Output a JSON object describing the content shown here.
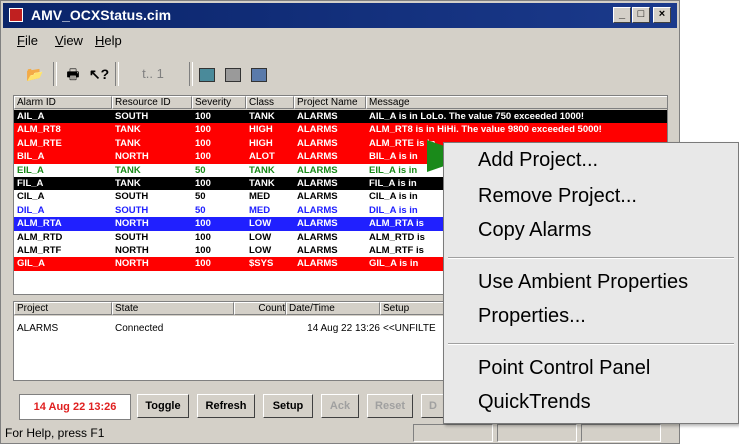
{
  "window": {
    "title": "AMV_OCXStatus.cim"
  },
  "menu": [
    "File",
    "View",
    "Help"
  ],
  "toolbar": {
    "num_label": "t..  1"
  },
  "alarm_grid": {
    "columns": [
      "Alarm ID",
      "Resource ID",
      "Severity",
      "Class",
      "Project Name",
      "Message"
    ],
    "rows": [
      {
        "cells": [
          "AIL_A",
          "SOUTH",
          "100",
          "TANK",
          "ALARMS",
          "AIL_A is in  LoLo. The value 750 exceeded 1000!"
        ],
        "bg": "#000000",
        "fg": "#ffffff"
      },
      {
        "cells": [
          "ALM_RT8",
          "TANK",
          "100",
          "HIGH",
          "ALARMS",
          "ALM_RT8 is in  HiHi. The value 9800 exceeded 5000!"
        ],
        "bg": "#ff0000",
        "fg": "#ffffff"
      },
      {
        "cells": [
          "ALM_RTE",
          "TANK",
          "100",
          "HIGH",
          "ALARMS",
          "ALM_RTE is in"
        ],
        "bg": "#ff0000",
        "fg": "#ffffff"
      },
      {
        "cells": [
          "BIL_A",
          "NORTH",
          "100",
          "ALOT",
          "ALARMS",
          "BIL_A is in"
        ],
        "bg": "#ff0000",
        "fg": "#ffffff"
      },
      {
        "cells": [
          "EIL_A",
          "TANK",
          "50",
          "TANK",
          "ALARMS",
          "EIL_A is in"
        ],
        "bg": "#ffffff",
        "fg": "#1a8a1a"
      },
      {
        "cells": [
          "FIL_A",
          "TANK",
          "100",
          "TANK",
          "ALARMS",
          "FIL_A is in"
        ],
        "bg": "#000000",
        "fg": "#ffffff"
      },
      {
        "cells": [
          "CIL_A",
          "SOUTH",
          "50",
          "MED",
          "ALARMS",
          "CIL_A is in"
        ],
        "bg": "#ffffff",
        "fg": "#000000"
      },
      {
        "cells": [
          "DIL_A",
          "SOUTH",
          "50",
          "MED",
          "ALARMS",
          "DIL_A is in"
        ],
        "bg": "#ffffff",
        "fg": "#2020ff"
      },
      {
        "cells": [
          "ALM_RTA",
          "NORTH",
          "100",
          "LOW",
          "ALARMS",
          "ALM_RTA is"
        ],
        "bg": "#2020ff",
        "fg": "#ffffff"
      },
      {
        "cells": [
          "ALM_RTD",
          "SOUTH",
          "100",
          "LOW",
          "ALARMS",
          "ALM_RTD is"
        ],
        "bg": "#ffffff",
        "fg": "#000000"
      },
      {
        "cells": [
          "ALM_RTF",
          "NORTH",
          "100",
          "LOW",
          "ALARMS",
          "ALM_RTF is"
        ],
        "bg": "#ffffff",
        "fg": "#000000"
      },
      {
        "cells": [
          "GIL_A",
          "NORTH",
          "100",
          "$SYS",
          "ALARMS",
          "GIL_A is in"
        ],
        "bg": "#ff0000",
        "fg": "#ffffff"
      }
    ]
  },
  "project_grid": {
    "columns": [
      "Project",
      "State",
      "Count",
      "Date/Time",
      "Setup"
    ],
    "rows": [
      {
        "cells": [
          "ALARMS",
          "Connected",
          "",
          "14 Aug 22 13:26",
          "<<UNFILTE"
        ]
      }
    ]
  },
  "bottom": {
    "clock": "14 Aug 22 13:26",
    "buttons": {
      "toggle": "Toggle",
      "refresh": "Refresh",
      "setup": "Setup",
      "ack": "Ack",
      "reset": "Reset",
      "d": "D"
    }
  },
  "status": {
    "text": "For Help, press F1"
  },
  "context_menu": {
    "add_project": "Add Project...",
    "remove_project": "Remove Project...",
    "copy_alarms": "Copy Alarms",
    "use_ambient": "Use Ambient Properties",
    "properties": "Properties...",
    "point_control": "Point Control Panel",
    "quicktrends": "QuickTrends"
  }
}
